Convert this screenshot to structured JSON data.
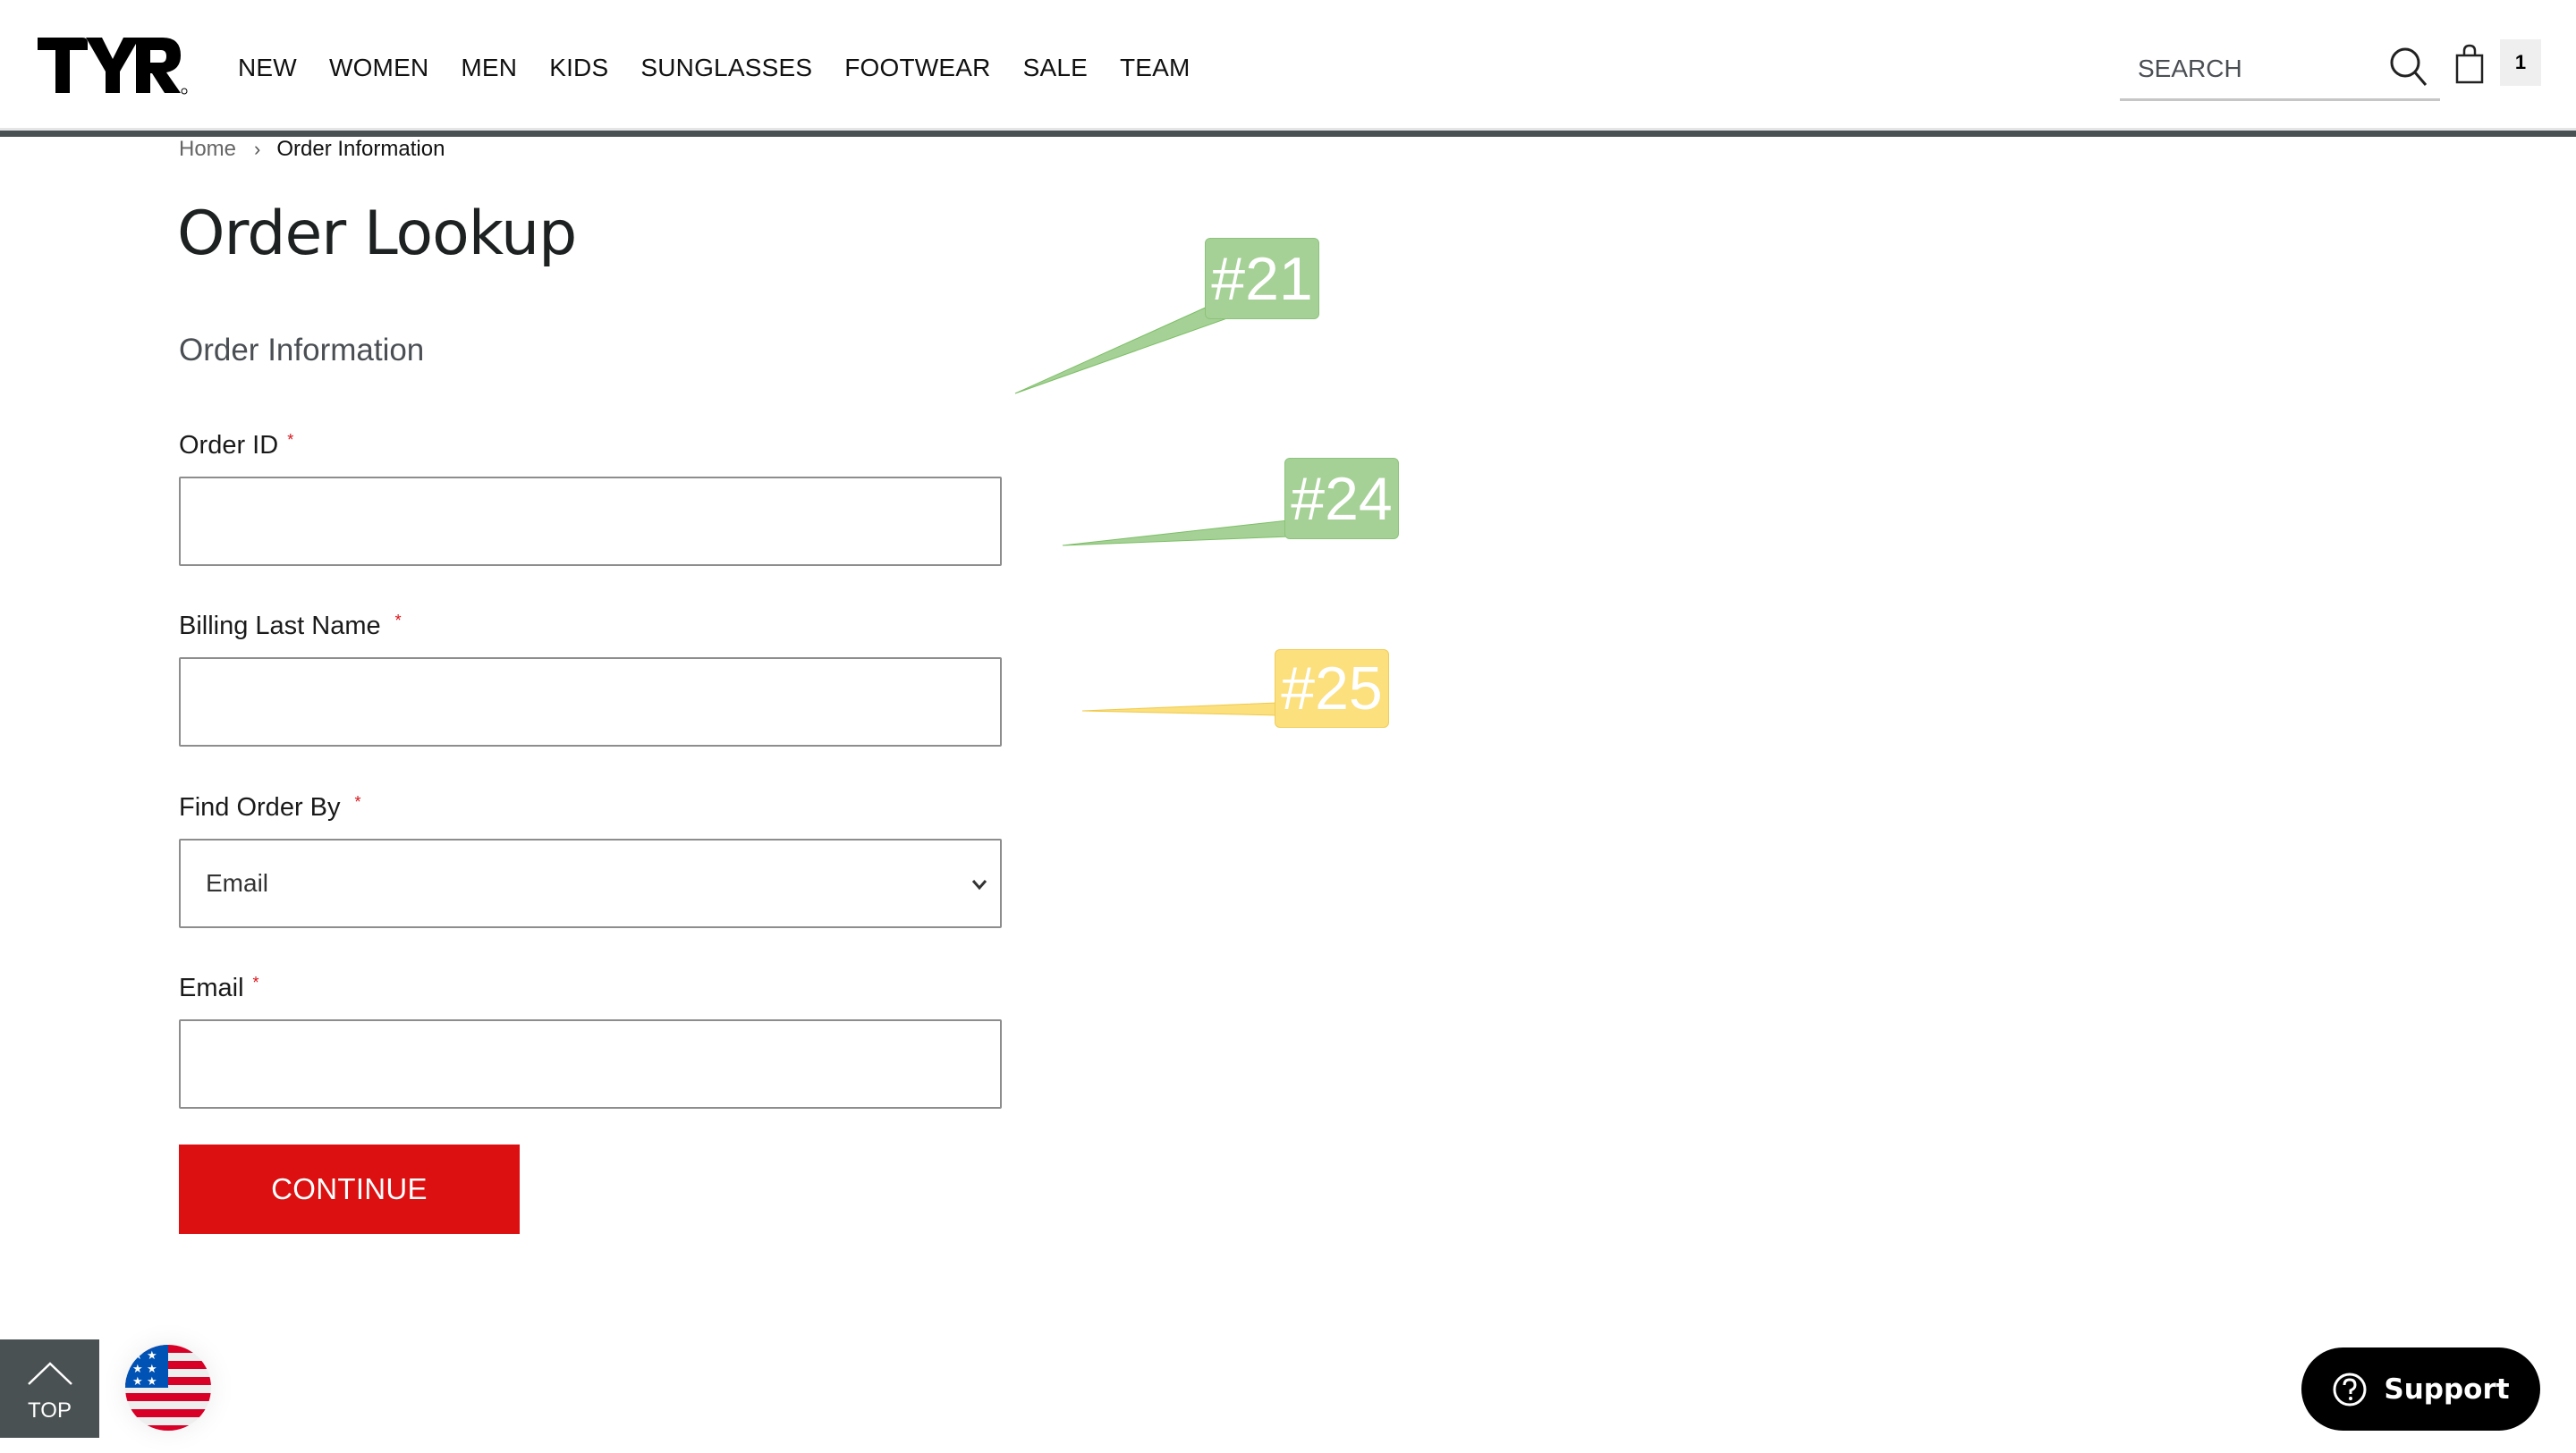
{
  "header": {
    "logo_text": "TYR",
    "nav": [
      "NEW",
      "WOMEN",
      "MEN",
      "KIDS",
      "SUNGLASSES",
      "FOOTWEAR",
      "SALE",
      "TEAM"
    ],
    "search": {
      "placeholder": "SEARCH",
      "value": ""
    },
    "cart_count": "1"
  },
  "breadcrumb": {
    "home": "Home",
    "separator": "›",
    "current": "Order Information"
  },
  "page": {
    "title": "Order Lookup",
    "section_title": "Order Information"
  },
  "form": {
    "order_id": {
      "label": "Order ID",
      "required_mark": "*",
      "value": ""
    },
    "billing_last_name": {
      "label": "Billing Last Name",
      "required_mark": "*",
      "value": ""
    },
    "find_order_by": {
      "label": "Find Order By",
      "required_mark": "*",
      "selected": "Email"
    },
    "email": {
      "label": "Email",
      "required_mark": "*",
      "value": ""
    },
    "continue_label": "CONTINUE"
  },
  "footer": {
    "top_label": "TOP",
    "country_flag": "us-flag",
    "support_label": "Support"
  },
  "annotations": [
    {
      "label": "#21",
      "color": "#a6d196"
    },
    {
      "label": "#24",
      "color": "#a6d196"
    },
    {
      "label": "#25",
      "color": "#fbe07d"
    }
  ],
  "colors": {
    "accent_red": "#dc1011",
    "header_bar": "#4a5153",
    "required": "#d9141b"
  }
}
